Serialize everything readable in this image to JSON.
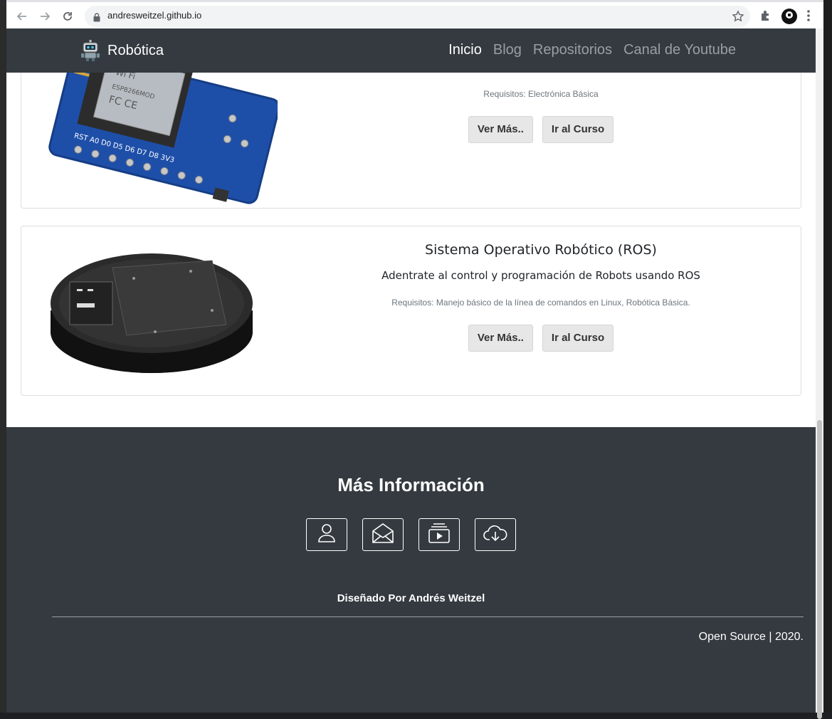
{
  "browser": {
    "url": "andresweitzel.github.io"
  },
  "navbar": {
    "brand": "Robótica",
    "links": [
      "Inicio",
      "Blog",
      "Repositorios",
      "Canal de Youtube"
    ]
  },
  "cards": [
    {
      "title": "",
      "description": "",
      "requirements": "Requisitos: Electrónica Básica",
      "more_label": "Ver Más..",
      "course_label": "Ir al Curso"
    },
    {
      "title": "Sistema Operativo Robótico (ROS)",
      "description": "Adentrate al control y programación de Robots usando ROS",
      "requirements": "Requisitos: Manejo básico de la línea de comandos en Linux, Robótica Básica.",
      "more_label": "Ver Más..",
      "course_label": "Ir al Curso"
    }
  ],
  "footer": {
    "heading": "Más Información",
    "icons": [
      "person-icon",
      "envelope-icon",
      "video-icon",
      "cloud-download-icon"
    ],
    "designed_by": "Diseñado Por Andrés Weitzel",
    "copyright": "Open Source | 2020."
  },
  "colors": {
    "navbar_bg": "#343a40",
    "footer_bg": "#343a40",
    "button_bg": "#e7e7e7"
  }
}
